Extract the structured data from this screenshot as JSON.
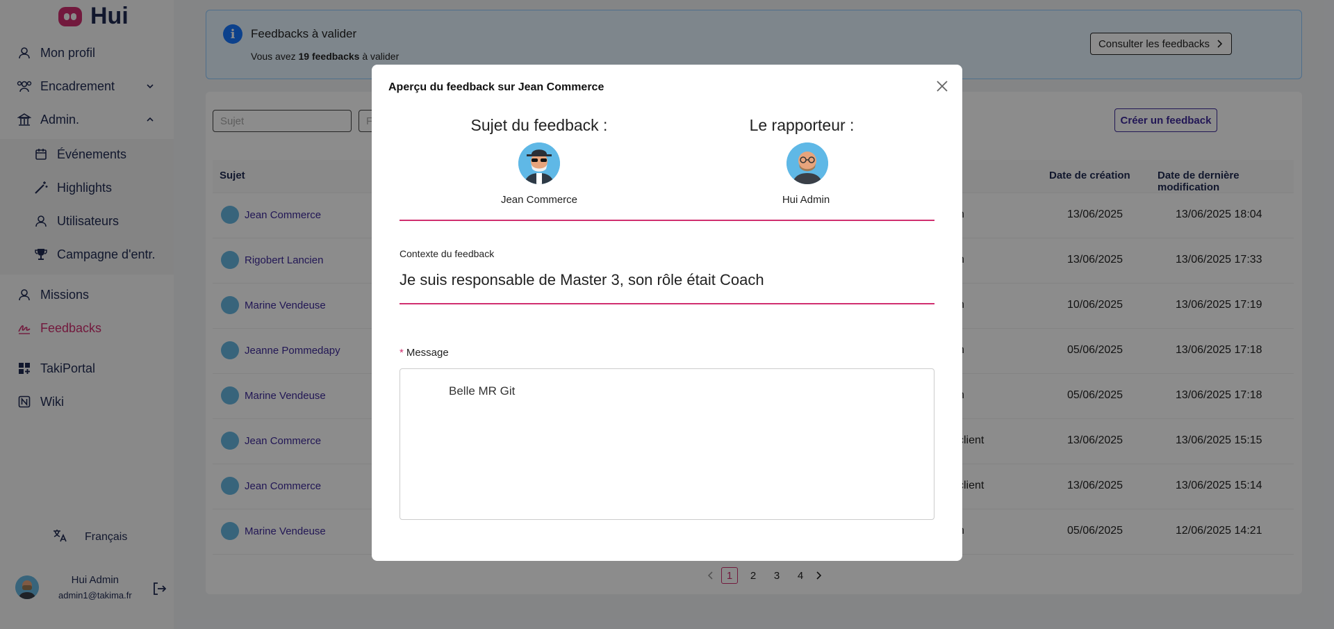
{
  "app": {
    "name": "Hui"
  },
  "sidebar": {
    "items": [
      {
        "label": "Mon profil"
      },
      {
        "label": "Encadrement"
      },
      {
        "label": "Admin."
      },
      {
        "label": "Événements"
      },
      {
        "label": "Highlights"
      },
      {
        "label": "Utilisateurs"
      },
      {
        "label": "Campagne d'entr."
      },
      {
        "label": "Missions"
      },
      {
        "label": "Feedbacks"
      },
      {
        "label": "TakiPortal"
      },
      {
        "label": "Wiki"
      }
    ],
    "language": "Français",
    "user": {
      "name": "Hui Admin",
      "email": "admin1@takima.fr"
    }
  },
  "banner": {
    "title": "Feedbacks à valider",
    "text_prefix": "Vous avez ",
    "text_count": "19 feedbacks",
    "text_suffix": " à valider",
    "button_label": "Consulter les feedbacks"
  },
  "toolbar": {
    "search_placeholder": "Sujet",
    "filter_placeholder": "F",
    "create_label": "Créer un feedback"
  },
  "table": {
    "headers": {
      "subject": "Sujet",
      "created": "Date de création",
      "modified": "Date de dernière modification"
    },
    "rows": [
      {
        "subject": "Jean Commerce",
        "c1": "n",
        "created": "13/06/2025",
        "modified": "13/06/2025 18:04"
      },
      {
        "subject": "Rigobert Lancien",
        "c1": "n",
        "created": "13/06/2025",
        "modified": "13/06/2025 17:33"
      },
      {
        "subject": "Marine Vendeuse",
        "c1": "n",
        "created": "10/06/2025",
        "modified": "13/06/2025 17:19"
      },
      {
        "subject": "Jeanne Pommedapy",
        "c1": "n",
        "created": "05/06/2025",
        "modified": "13/06/2025 17:18"
      },
      {
        "subject": "Marine Vendeuse",
        "c1": "n",
        "created": "05/06/2025",
        "modified": "13/06/2025 17:18"
      },
      {
        "subject": "Jean Commerce",
        "c1": "client",
        "created": "13/06/2025",
        "modified": "13/06/2025 15:15"
      },
      {
        "subject": "Jean Commerce",
        "c1": "client",
        "created": "13/06/2025",
        "modified": "13/06/2025 15:14"
      },
      {
        "subject": "Marine Vendeuse",
        "c1": "n",
        "created": "05/06/2025",
        "modified": "12/06/2025 14:21"
      }
    ]
  },
  "pagination": {
    "pages": [
      "1",
      "2",
      "3",
      "4"
    ],
    "current": "1"
  },
  "modal": {
    "title": "Aperçu du feedback sur Jean Commerce",
    "subject_title": "Sujet du feedback :",
    "subject_name": "Jean Commerce",
    "reporter_title": "Le rapporteur :",
    "reporter_name": "Hui Admin",
    "context_label": "Contexte du feedback",
    "context_text": "Je suis responsable de Master 3, son rôle était Coach",
    "message_label": "Message",
    "message_required": "*",
    "message_text": "Belle MR Git"
  },
  "colors": {
    "accent": "#d02f6f",
    "primary": "#3f2a9b",
    "info": "#1677ff"
  }
}
